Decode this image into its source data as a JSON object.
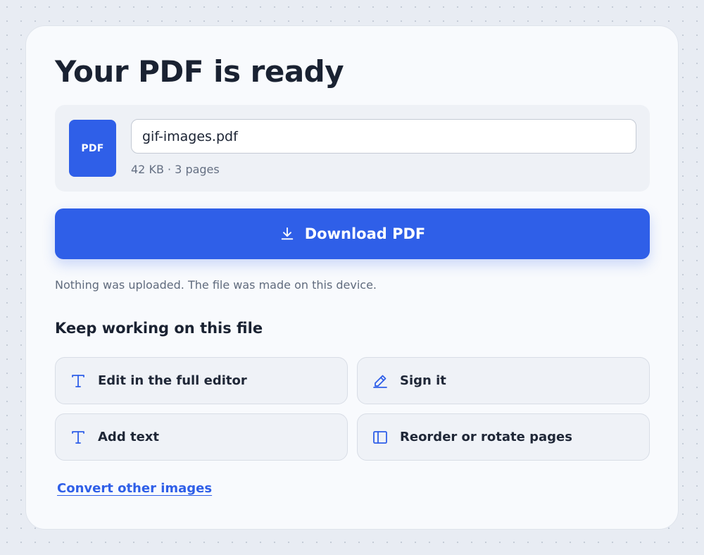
{
  "page": {
    "title": "Your PDF is ready"
  },
  "file": {
    "badge": "PDF",
    "name": "gif-images.pdf",
    "meta": "42  KB · 3 pages"
  },
  "download": {
    "label": "Download PDF",
    "icon": "download-icon"
  },
  "privacy_note": "Nothing was uploaded. The file was made on this device.",
  "next_steps": {
    "title": "Keep working on this file",
    "actions": [
      {
        "label": "Edit in the full editor",
        "icon": "text-icon"
      },
      {
        "label": "Sign it",
        "icon": "pen-icon"
      },
      {
        "label": "Add text",
        "icon": "text-icon"
      },
      {
        "label": "Reorder or rotate pages",
        "icon": "pages-panel-icon"
      }
    ]
  },
  "convert_link": "Convert other images",
  "colors": {
    "accent": "#2f5fe8",
    "background": "#e8ecf3",
    "card": "#f8fafd",
    "text": "#1a2232",
    "muted": "#606b7d"
  }
}
